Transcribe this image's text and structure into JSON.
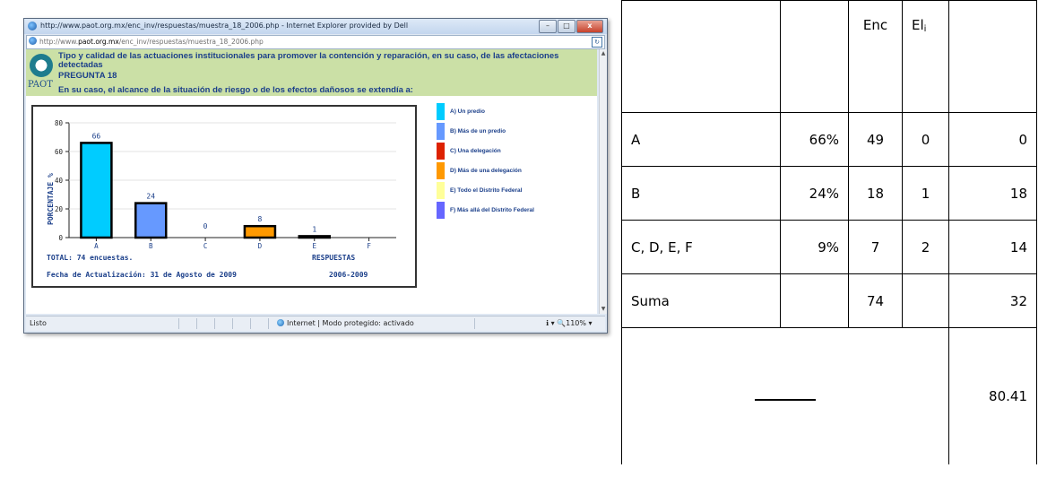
{
  "browser": {
    "title": "http://www.paot.org.mx/enc_inv/respuestas/muestra_18_2006.php - Internet Explorer provided by Dell",
    "address_prefix": "http://www.",
    "address_domain": "paot.org.mx",
    "address_path": "/enc_inv/respuestas/muestra_18_2006.php",
    "status_left": "Listo",
    "status_zone": "Internet | Modo protegido: activado",
    "status_zoom": "ℹ ▾  🔍110%  ▾",
    "buttons": {
      "minimize": "–",
      "maximize": "□",
      "close": "x"
    }
  },
  "page": {
    "logo_text": "PAOT",
    "title": "Tipo y calidad de las actuaciones institucionales para promover la contención y reparación, en su caso, de las afectaciones detectadas",
    "pregunta": "PREGUNTA 18",
    "question": "En su caso, el alcance de la situación de riesgo o de los efectos dañosos se extendía a:",
    "total": "TOTAL: 74 encuestas.",
    "respuestas": "RESPUESTAS",
    "fecha": "Fecha de Actualización: 31 de Agosto de 2009",
    "periodo": "2006-2009"
  },
  "chart_data": {
    "type": "bar",
    "ylabel": "PORCENTAJE %",
    "xlabel": "RESPUESTAS",
    "ylim": [
      0,
      80
    ],
    "yticks": [
      0,
      20,
      40,
      60,
      80
    ],
    "categories": [
      "A",
      "B",
      "C",
      "D",
      "E",
      "F"
    ],
    "values": [
      66,
      24,
      0,
      8,
      1,
      null
    ],
    "value_labels": [
      "66",
      "24",
      "0",
      "8",
      "1",
      ""
    ],
    "colors": [
      "#00ccff",
      "#6699ff",
      "#dd2200",
      "#ff9900",
      "#ffff99",
      "#6666ff"
    ],
    "legend": [
      {
        "label": "A) Un predio",
        "color": "#00ccff"
      },
      {
        "label": "B) Más de un predio",
        "color": "#6699ff"
      },
      {
        "label": "C) Una delegación",
        "color": "#dd2200"
      },
      {
        "label": "D) Más de una delegación",
        "color": "#ff9900"
      },
      {
        "label": "E) Todo el Distrito Federal",
        "color": "#ffff99"
      },
      {
        "label": "F) Más allá del Distrito Federal",
        "color": "#6666ff"
      }
    ]
  },
  "table": {
    "header": [
      "",
      "",
      "Enc",
      "El",
      ""
    ],
    "header_sub": "i",
    "rows": [
      [
        "A",
        "66%",
        "49",
        "0",
        "0"
      ],
      [
        "B",
        "24%",
        "18",
        "1",
        "18"
      ],
      [
        "C, D, E, F",
        "9%",
        "7",
        "2",
        "14"
      ],
      [
        "Suma",
        "",
        "74",
        "",
        "32"
      ]
    ],
    "result": "80.41"
  }
}
